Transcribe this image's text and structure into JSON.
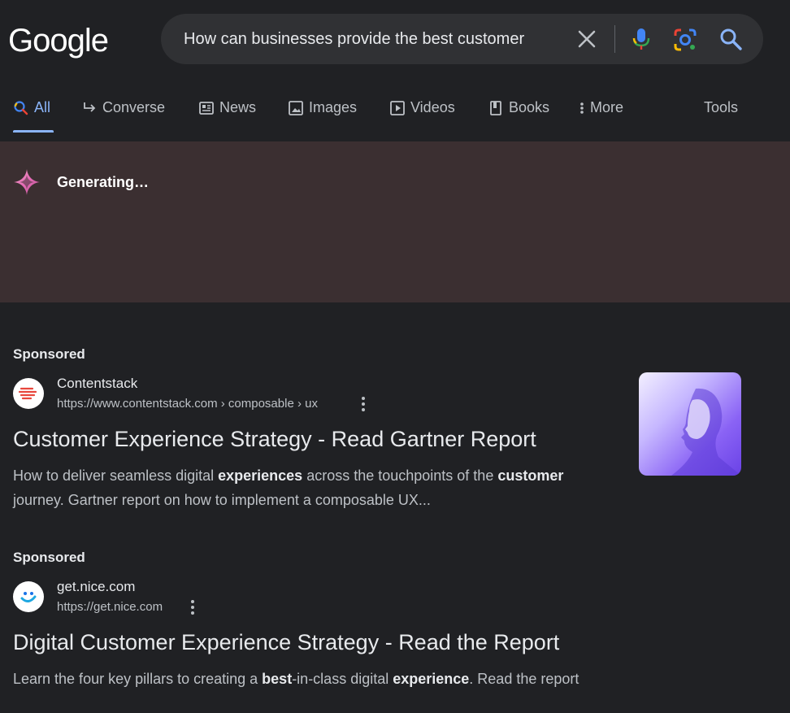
{
  "logo": "Google",
  "search": {
    "query": "How can businesses provide the best customer"
  },
  "tabs": [
    {
      "label": "All",
      "icon": "search-icon"
    },
    {
      "label": "Converse",
      "icon": "return-arrow-icon"
    },
    {
      "label": "News",
      "icon": "news-icon"
    },
    {
      "label": "Images",
      "icon": "image-icon"
    },
    {
      "label": "Videos",
      "icon": "video-icon"
    },
    {
      "label": "Books",
      "icon": "book-icon"
    },
    {
      "label": "More",
      "icon": "vertical-dots-icon"
    }
  ],
  "tools_label": "Tools",
  "ai": {
    "status": "Generating…"
  },
  "ads": [
    {
      "sponsored": "Sponsored",
      "site": "Contentstack",
      "url": "https://www.contentstack.com › composable › ux",
      "title": "Customer Experience Strategy - Read Gartner Report",
      "desc": [
        {
          "t": "How to deliver seamless digital ",
          "b": false
        },
        {
          "t": "experiences",
          "b": true
        },
        {
          "t": " across the touchpoints of the ",
          "b": false
        },
        {
          "t": "customer",
          "b": true
        },
        {
          "t": " journey. Gartner report on how to implement a composable UX...",
          "b": false
        }
      ]
    },
    {
      "sponsored": "Sponsored",
      "site": "get.nice.com",
      "url": "https://get.nice.com",
      "title": "Digital Customer Experience Strategy - Read the Report",
      "desc": [
        {
          "t": "Learn the four key pillars to creating a ",
          "b": false
        },
        {
          "t": "best",
          "b": true
        },
        {
          "t": "-in-class digital ",
          "b": false
        },
        {
          "t": "experience",
          "b": true
        },
        {
          "t": ". Read the report",
          "b": false
        }
      ]
    }
  ],
  "colors": {
    "accent": "#8ab4f8",
    "background": "#202124",
    "ai_panel": "#3b2f31"
  }
}
